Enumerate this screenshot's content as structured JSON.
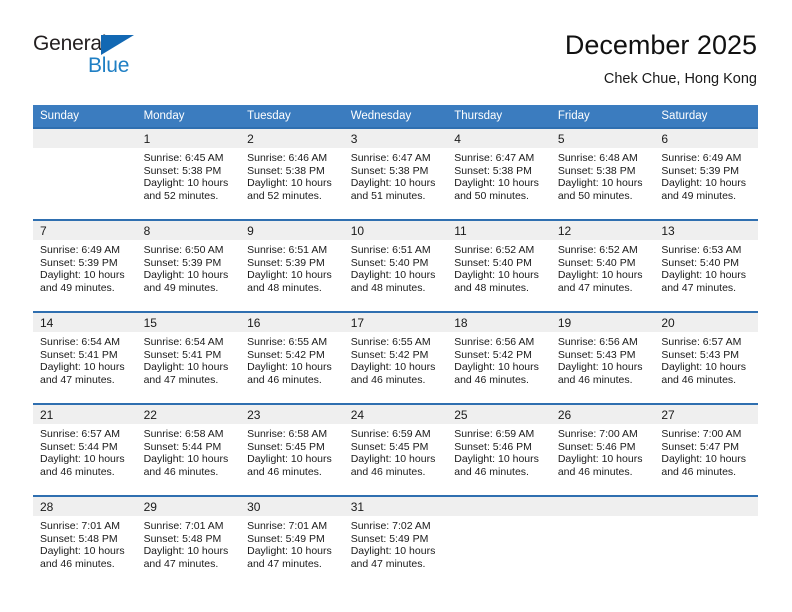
{
  "brand": {
    "name_top": "General",
    "name_bottom": "Blue",
    "triangle_color": "#1268b3",
    "blue_text_color": "#1f7fc4"
  },
  "header": {
    "title": "December 2025",
    "subtitle": "Chek Chue, Hong Kong"
  },
  "theme": {
    "header_blue": "#3b7cbf",
    "row_divider_blue": "#2f6fb0",
    "daynum_band": "#efefef"
  },
  "weekday_headers": [
    "Sunday",
    "Monday",
    "Tuesday",
    "Wednesday",
    "Thursday",
    "Friday",
    "Saturday"
  ],
  "labels": {
    "sunrise_prefix": "Sunrise:",
    "sunset_prefix": "Sunset:",
    "daylight_prefix": "Daylight:"
  },
  "weeks": [
    [
      {
        "day": "",
        "sunrise": "",
        "sunset": "",
        "daylight_line1": "",
        "daylight_line2": ""
      },
      {
        "day": "1",
        "sunrise": "Sunrise: 6:45 AM",
        "sunset": "Sunset: 5:38 PM",
        "daylight_line1": "Daylight: 10 hours",
        "daylight_line2": "and 52 minutes."
      },
      {
        "day": "2",
        "sunrise": "Sunrise: 6:46 AM",
        "sunset": "Sunset: 5:38 PM",
        "daylight_line1": "Daylight: 10 hours",
        "daylight_line2": "and 52 minutes."
      },
      {
        "day": "3",
        "sunrise": "Sunrise: 6:47 AM",
        "sunset": "Sunset: 5:38 PM",
        "daylight_line1": "Daylight: 10 hours",
        "daylight_line2": "and 51 minutes."
      },
      {
        "day": "4",
        "sunrise": "Sunrise: 6:47 AM",
        "sunset": "Sunset: 5:38 PM",
        "daylight_line1": "Daylight: 10 hours",
        "daylight_line2": "and 50 minutes."
      },
      {
        "day": "5",
        "sunrise": "Sunrise: 6:48 AM",
        "sunset": "Sunset: 5:38 PM",
        "daylight_line1": "Daylight: 10 hours",
        "daylight_line2": "and 50 minutes."
      },
      {
        "day": "6",
        "sunrise": "Sunrise: 6:49 AM",
        "sunset": "Sunset: 5:39 PM",
        "daylight_line1": "Daylight: 10 hours",
        "daylight_line2": "and 49 minutes."
      }
    ],
    [
      {
        "day": "7",
        "sunrise": "Sunrise: 6:49 AM",
        "sunset": "Sunset: 5:39 PM",
        "daylight_line1": "Daylight: 10 hours",
        "daylight_line2": "and 49 minutes."
      },
      {
        "day": "8",
        "sunrise": "Sunrise: 6:50 AM",
        "sunset": "Sunset: 5:39 PM",
        "daylight_line1": "Daylight: 10 hours",
        "daylight_line2": "and 49 minutes."
      },
      {
        "day": "9",
        "sunrise": "Sunrise: 6:51 AM",
        "sunset": "Sunset: 5:39 PM",
        "daylight_line1": "Daylight: 10 hours",
        "daylight_line2": "and 48 minutes."
      },
      {
        "day": "10",
        "sunrise": "Sunrise: 6:51 AM",
        "sunset": "Sunset: 5:40 PM",
        "daylight_line1": "Daylight: 10 hours",
        "daylight_line2": "and 48 minutes."
      },
      {
        "day": "11",
        "sunrise": "Sunrise: 6:52 AM",
        "sunset": "Sunset: 5:40 PM",
        "daylight_line1": "Daylight: 10 hours",
        "daylight_line2": "and 48 minutes."
      },
      {
        "day": "12",
        "sunrise": "Sunrise: 6:52 AM",
        "sunset": "Sunset: 5:40 PM",
        "daylight_line1": "Daylight: 10 hours",
        "daylight_line2": "and 47 minutes."
      },
      {
        "day": "13",
        "sunrise": "Sunrise: 6:53 AM",
        "sunset": "Sunset: 5:40 PM",
        "daylight_line1": "Daylight: 10 hours",
        "daylight_line2": "and 47 minutes."
      }
    ],
    [
      {
        "day": "14",
        "sunrise": "Sunrise: 6:54 AM",
        "sunset": "Sunset: 5:41 PM",
        "daylight_line1": "Daylight: 10 hours",
        "daylight_line2": "and 47 minutes."
      },
      {
        "day": "15",
        "sunrise": "Sunrise: 6:54 AM",
        "sunset": "Sunset: 5:41 PM",
        "daylight_line1": "Daylight: 10 hours",
        "daylight_line2": "and 47 minutes."
      },
      {
        "day": "16",
        "sunrise": "Sunrise: 6:55 AM",
        "sunset": "Sunset: 5:42 PM",
        "daylight_line1": "Daylight: 10 hours",
        "daylight_line2": "and 46 minutes."
      },
      {
        "day": "17",
        "sunrise": "Sunrise: 6:55 AM",
        "sunset": "Sunset: 5:42 PM",
        "daylight_line1": "Daylight: 10 hours",
        "daylight_line2": "and 46 minutes."
      },
      {
        "day": "18",
        "sunrise": "Sunrise: 6:56 AM",
        "sunset": "Sunset: 5:42 PM",
        "daylight_line1": "Daylight: 10 hours",
        "daylight_line2": "and 46 minutes."
      },
      {
        "day": "19",
        "sunrise": "Sunrise: 6:56 AM",
        "sunset": "Sunset: 5:43 PM",
        "daylight_line1": "Daylight: 10 hours",
        "daylight_line2": "and 46 minutes."
      },
      {
        "day": "20",
        "sunrise": "Sunrise: 6:57 AM",
        "sunset": "Sunset: 5:43 PM",
        "daylight_line1": "Daylight: 10 hours",
        "daylight_line2": "and 46 minutes."
      }
    ],
    [
      {
        "day": "21",
        "sunrise": "Sunrise: 6:57 AM",
        "sunset": "Sunset: 5:44 PM",
        "daylight_line1": "Daylight: 10 hours",
        "daylight_line2": "and 46 minutes."
      },
      {
        "day": "22",
        "sunrise": "Sunrise: 6:58 AM",
        "sunset": "Sunset: 5:44 PM",
        "daylight_line1": "Daylight: 10 hours",
        "daylight_line2": "and 46 minutes."
      },
      {
        "day": "23",
        "sunrise": "Sunrise: 6:58 AM",
        "sunset": "Sunset: 5:45 PM",
        "daylight_line1": "Daylight: 10 hours",
        "daylight_line2": "and 46 minutes."
      },
      {
        "day": "24",
        "sunrise": "Sunrise: 6:59 AM",
        "sunset": "Sunset: 5:45 PM",
        "daylight_line1": "Daylight: 10 hours",
        "daylight_line2": "and 46 minutes."
      },
      {
        "day": "25",
        "sunrise": "Sunrise: 6:59 AM",
        "sunset": "Sunset: 5:46 PM",
        "daylight_line1": "Daylight: 10 hours",
        "daylight_line2": "and 46 minutes."
      },
      {
        "day": "26",
        "sunrise": "Sunrise: 7:00 AM",
        "sunset": "Sunset: 5:46 PM",
        "daylight_line1": "Daylight: 10 hours",
        "daylight_line2": "and 46 minutes."
      },
      {
        "day": "27",
        "sunrise": "Sunrise: 7:00 AM",
        "sunset": "Sunset: 5:47 PM",
        "daylight_line1": "Daylight: 10 hours",
        "daylight_line2": "and 46 minutes."
      }
    ],
    [
      {
        "day": "28",
        "sunrise": "Sunrise: 7:01 AM",
        "sunset": "Sunset: 5:48 PM",
        "daylight_line1": "Daylight: 10 hours",
        "daylight_line2": "and 46 minutes."
      },
      {
        "day": "29",
        "sunrise": "Sunrise: 7:01 AM",
        "sunset": "Sunset: 5:48 PM",
        "daylight_line1": "Daylight: 10 hours",
        "daylight_line2": "and 47 minutes."
      },
      {
        "day": "30",
        "sunrise": "Sunrise: 7:01 AM",
        "sunset": "Sunset: 5:49 PM",
        "daylight_line1": "Daylight: 10 hours",
        "daylight_line2": "and 47 minutes."
      },
      {
        "day": "31",
        "sunrise": "Sunrise: 7:02 AM",
        "sunset": "Sunset: 5:49 PM",
        "daylight_line1": "Daylight: 10 hours",
        "daylight_line2": "and 47 minutes."
      },
      {
        "day": "",
        "sunrise": "",
        "sunset": "",
        "daylight_line1": "",
        "daylight_line2": ""
      },
      {
        "day": "",
        "sunrise": "",
        "sunset": "",
        "daylight_line1": "",
        "daylight_line2": ""
      },
      {
        "day": "",
        "sunrise": "",
        "sunset": "",
        "daylight_line1": "",
        "daylight_line2": ""
      }
    ]
  ]
}
